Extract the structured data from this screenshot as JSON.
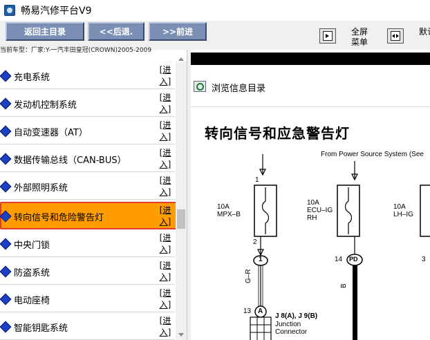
{
  "window": {
    "title": "畅易汽修平台V9"
  },
  "toolbar": {
    "home_label": "返回主目录",
    "back_label": "<<后退.",
    "forward_label": ">>前进",
    "fullscreen_label": "全屏菜单",
    "default_label": "默认"
  },
  "vehicle": {
    "text": "当前车型：厂家:Y-一汽丰田皇冠(CROWN)2005-2009"
  },
  "menu": {
    "enter_label": "[进入]",
    "items": [
      {
        "label": "充电系统"
      },
      {
        "label": "发动机控制系统"
      },
      {
        "label": "自动变速器（AT）"
      },
      {
        "label": "数据传输总线（CAN-BUS）"
      },
      {
        "label": "外部照明系统"
      },
      {
        "label": "转向信号和危险警告灯",
        "selected": true
      },
      {
        "label": "中央门锁"
      },
      {
        "label": "防盗系统"
      },
      {
        "label": "电动座椅"
      },
      {
        "label": "智能钥匙系统"
      }
    ]
  },
  "content": {
    "browse_label": "浏览信息目录",
    "diagram_title": "转向信号和应急警告灯",
    "from_power": "From Power Source System (See",
    "fuses": [
      {
        "amp": "10A",
        "name": "MPX–B"
      },
      {
        "amp": "10A",
        "name": "ECU–IG RH"
      },
      {
        "amp": "10A",
        "name": "LH–IG"
      }
    ],
    "pins": {
      "p1": "1",
      "p2": "2",
      "p14": "14",
      "p3": "3",
      "p13": "13"
    },
    "connectors": {
      "c1": "1",
      "pd": "PD",
      "a": "A"
    },
    "wire_colors": {
      "gr": "G–R",
      "b": "B"
    },
    "junction": {
      "line1": "J 8(A), J 9(B)",
      "line2": "Junction",
      "line3": "Connector"
    }
  }
}
